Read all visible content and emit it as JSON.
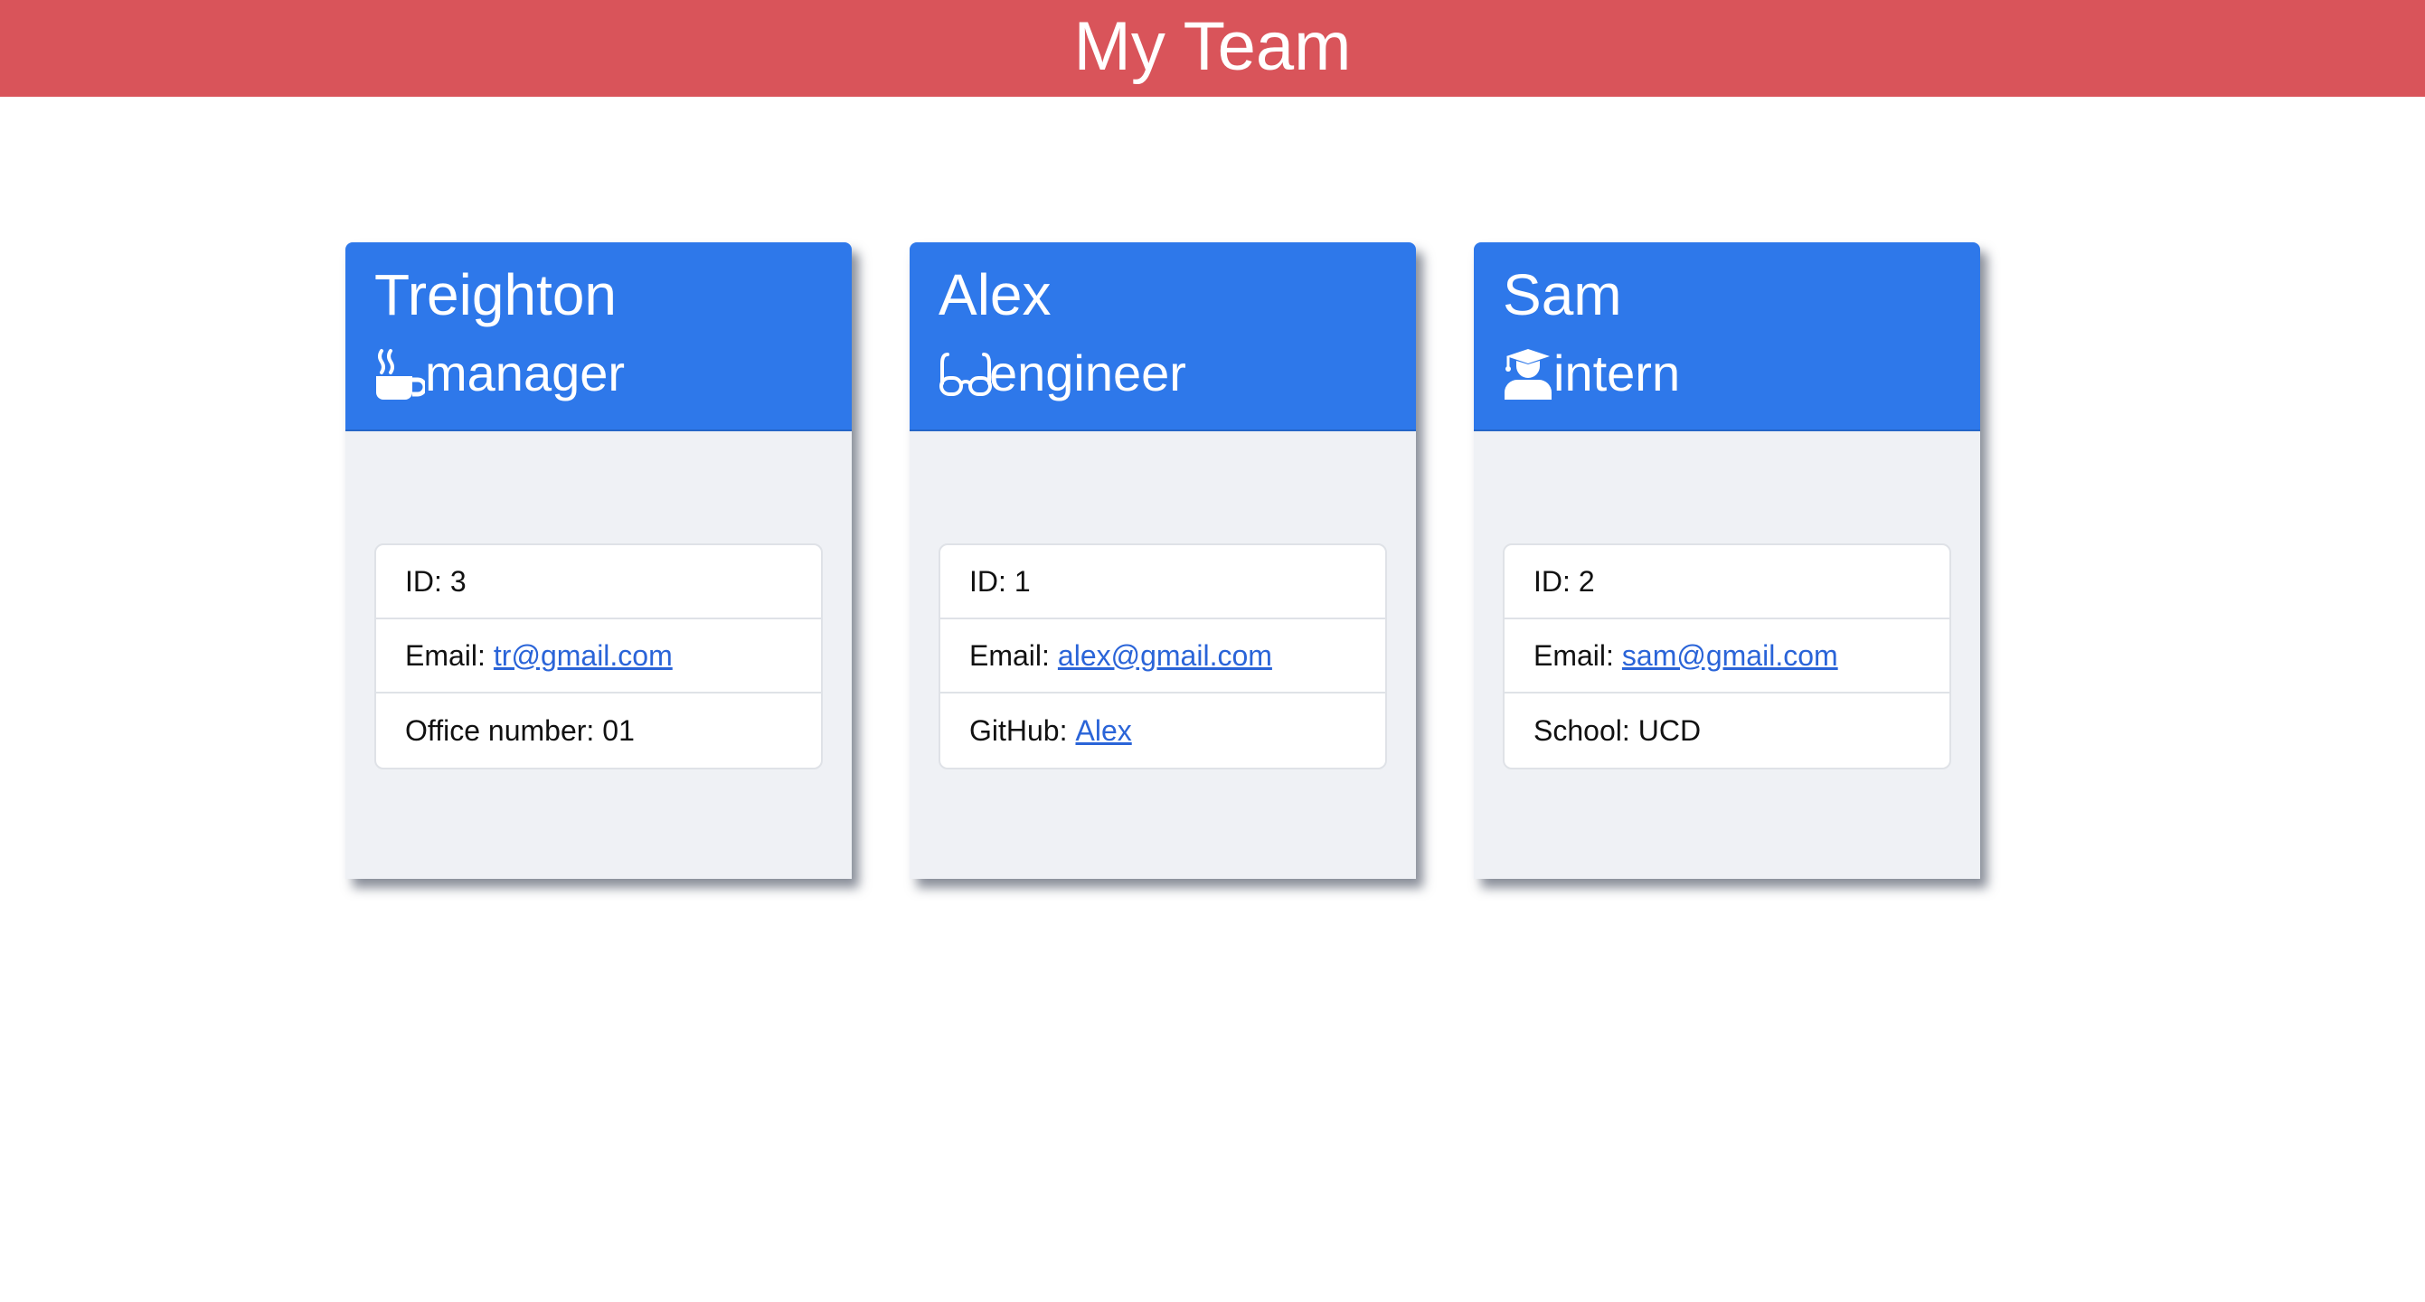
{
  "header": {
    "title": "My Team"
  },
  "team": [
    {
      "name": "Treighton",
      "role": "manager",
      "role_icon": "coffee-icon",
      "id_label": "ID:",
      "id": "3",
      "email_label": "Email:",
      "email": "tr@gmail.com",
      "extra_label": "Office number:",
      "extra_value": "01"
    },
    {
      "name": "Alex",
      "role": "engineer",
      "role_icon": "glasses-icon",
      "id_label": "ID:",
      "id": "1",
      "email_label": "Email:",
      "email": "alex@gmail.com",
      "extra_label": "GitHub:",
      "extra_value": "Alex"
    },
    {
      "name": "Sam",
      "role": "intern",
      "role_icon": "graduate-icon",
      "id_label": "ID:",
      "id": "2",
      "email_label": "Email:",
      "email": "sam@gmail.com",
      "extra_label": "School:",
      "extra_value": "UCD"
    }
  ],
  "colors": {
    "header_bg": "#d9545a",
    "card_header_bg": "#2e78ea",
    "card_body_bg": "#eff1f5",
    "link": "#2a64d8"
  }
}
